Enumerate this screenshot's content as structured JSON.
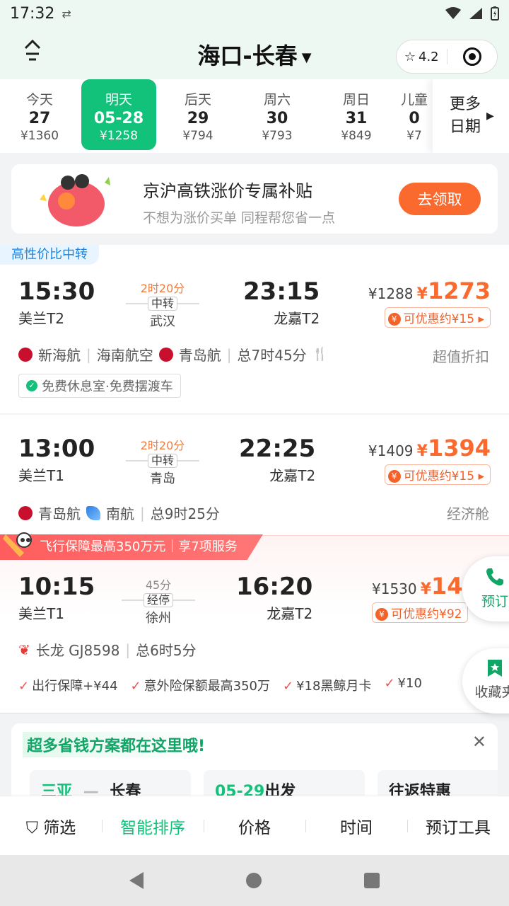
{
  "status": {
    "time": "17:32"
  },
  "header": {
    "title": "海口-长春",
    "rating": "4.2"
  },
  "dates": [
    {
      "label": "今天",
      "day": "27",
      "price": "¥1360"
    },
    {
      "label": "明天",
      "day": "05-28",
      "price": "¥1258"
    },
    {
      "label": "后天",
      "day": "29",
      "price": "¥794"
    },
    {
      "label": "周六",
      "day": "30",
      "price": "¥793"
    },
    {
      "label": "周日",
      "day": "31",
      "price": "¥849"
    },
    {
      "label": "儿童",
      "day": "0",
      "price": "¥7"
    }
  ],
  "more_dates": {
    "line1": "更多",
    "line2": "日期"
  },
  "promo": {
    "title": "京沪高铁涨价专属补贴",
    "subtitle": "不想为涨价买单 同程帮您省一点",
    "button": "去领取"
  },
  "flights": [
    {
      "tag": "高性价比中转",
      "dep_time": "15:30",
      "dep_airport": "美兰T2",
      "duration": "2时20分",
      "stop_type": "中转",
      "stop_city": "武汉",
      "arr_time": "23:15",
      "arr_airport": "龙嘉T2",
      "price_old": "¥1288",
      "price_new": "1273",
      "coupon": "可优惠约¥15",
      "airline1": "新海航",
      "airline2": "海南航空",
      "airline3": "青岛航",
      "total": "总7时45分",
      "cabin": "超值折扣",
      "benefit": "免费休息室·免费摆渡车"
    },
    {
      "dep_time": "13:00",
      "dep_airport": "美兰T1",
      "duration": "2时20分",
      "stop_type": "中转",
      "stop_city": "青岛",
      "arr_time": "22:25",
      "arr_airport": "龙嘉T2",
      "price_old": "¥1409",
      "price_new": "1394",
      "coupon": "可优惠约¥15",
      "airline1": "青岛航",
      "airline2": "南航",
      "total": "总9时25分",
      "cabin": "经济舱"
    },
    {
      "banner": "飞行保障最高350万元｜享7项服务",
      "dep_time": "10:15",
      "dep_airport": "美兰T1",
      "duration": "45分",
      "stop_type": "经停",
      "stop_city": "徐州",
      "arr_time": "16:20",
      "arr_airport": "龙嘉T2",
      "price_old": "¥1530",
      "price_new": "14",
      "coupon": "可优惠约¥92",
      "airline1": "长龙 GJ8598",
      "total": "总6时5分",
      "services": [
        "出行保障+¥44",
        "意外险保额最高350万",
        "¥18黑鲸月卡",
        "¥10"
      ]
    }
  ],
  "float_buttons": {
    "book": "预订",
    "favorite": "收藏夹"
  },
  "save_card": {
    "title": "超多省钱方案都在这里哦!",
    "tile1_from": "三亚",
    "tile1_to": "长春",
    "tile2_date": "05-29",
    "tile2_text": "出发",
    "tile3": "往返特惠"
  },
  "bottom_bar": [
    "筛选",
    "智能排序",
    "价格",
    "时间",
    "预订工具"
  ],
  "colors": {
    "accent": "#12c27a",
    "price": "#fa6a2e",
    "tag_blue": "#1a86e0"
  }
}
